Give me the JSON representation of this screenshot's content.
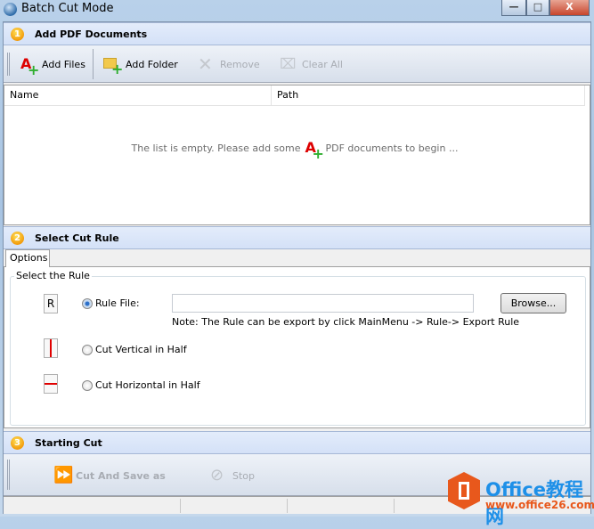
{
  "window": {
    "title": "Batch Cut Mode",
    "minimize": "—",
    "maximize": "□",
    "close": "X"
  },
  "section1": {
    "number": "1",
    "title": "Add PDF Documents",
    "toolbar": {
      "add_files": "Add Files",
      "add_folder": "Add Folder",
      "remove": "Remove",
      "clear_all": "Clear All"
    },
    "list": {
      "columns": [
        "Name",
        "Path"
      ],
      "empty_before": "The list is empty. Please add some",
      "empty_after": "PDF documents to begin ..."
    }
  },
  "section2": {
    "number": "2",
    "title": "Select Cut Rule",
    "tab": "Options",
    "group": "Select the Rule",
    "rule_file": {
      "icon_letter": "R",
      "label": "Rule File:",
      "value": "",
      "selected": true
    },
    "browse": "Browse...",
    "note": "Note: The Rule can be export by click MainMenu -> Rule-> Export Rule",
    "vertical": "Cut Vertical in Half",
    "horizontal": "Cut Horizontal in Half"
  },
  "section3": {
    "number": "3",
    "title": "Starting Cut",
    "toolbar": {
      "cut_save": "Cut And Save as",
      "stop": "Stop"
    }
  },
  "watermark": {
    "brand": "Office教程网",
    "url": "www.office26.com"
  },
  "colors": {
    "accent_orange": "#f29b0b",
    "watermark": "#e8581c",
    "cut_line": "#e00000"
  }
}
